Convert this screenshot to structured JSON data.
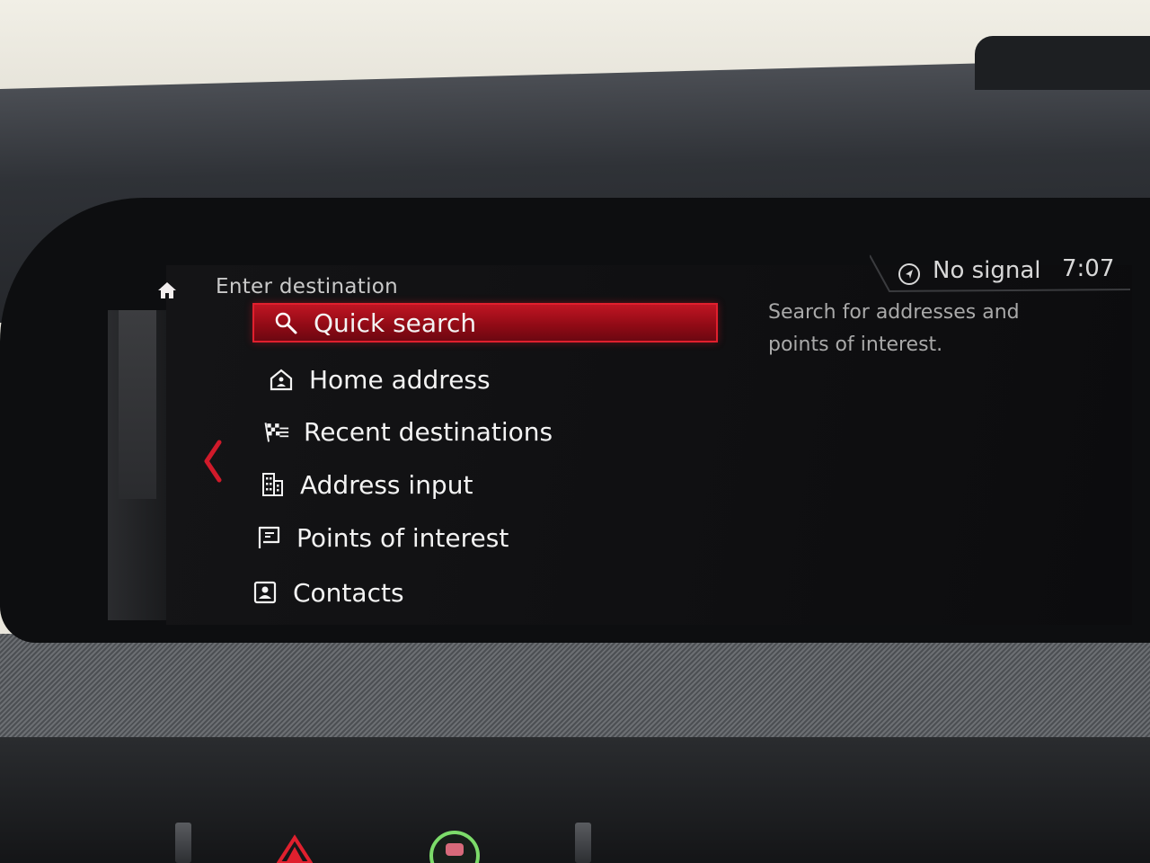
{
  "screen": {
    "title": "Enter destination",
    "status": {
      "signal_text": "No signal",
      "time": "7:07"
    },
    "description": "Search for addresses and points of interest.",
    "menu": [
      {
        "label": "Quick search",
        "icon": "search-icon",
        "selected": true
      },
      {
        "label": "Home address",
        "icon": "home-address-icon",
        "selected": false
      },
      {
        "label": "Recent destinations",
        "icon": "checkered-flag-icon",
        "selected": false
      },
      {
        "label": "Address input",
        "icon": "building-icon",
        "selected": false
      },
      {
        "label": "Points of interest",
        "icon": "poi-flag-icon",
        "selected": false
      },
      {
        "label": "Contacts",
        "icon": "contact-card-icon",
        "selected": false
      }
    ],
    "colors": {
      "accent": "#c01523",
      "text": "#f3f3f3",
      "muted": "#a9a9a9"
    }
  },
  "dashboard": {
    "hazard_color": "#e0202e",
    "green_button_color": "#7cdc6a"
  }
}
